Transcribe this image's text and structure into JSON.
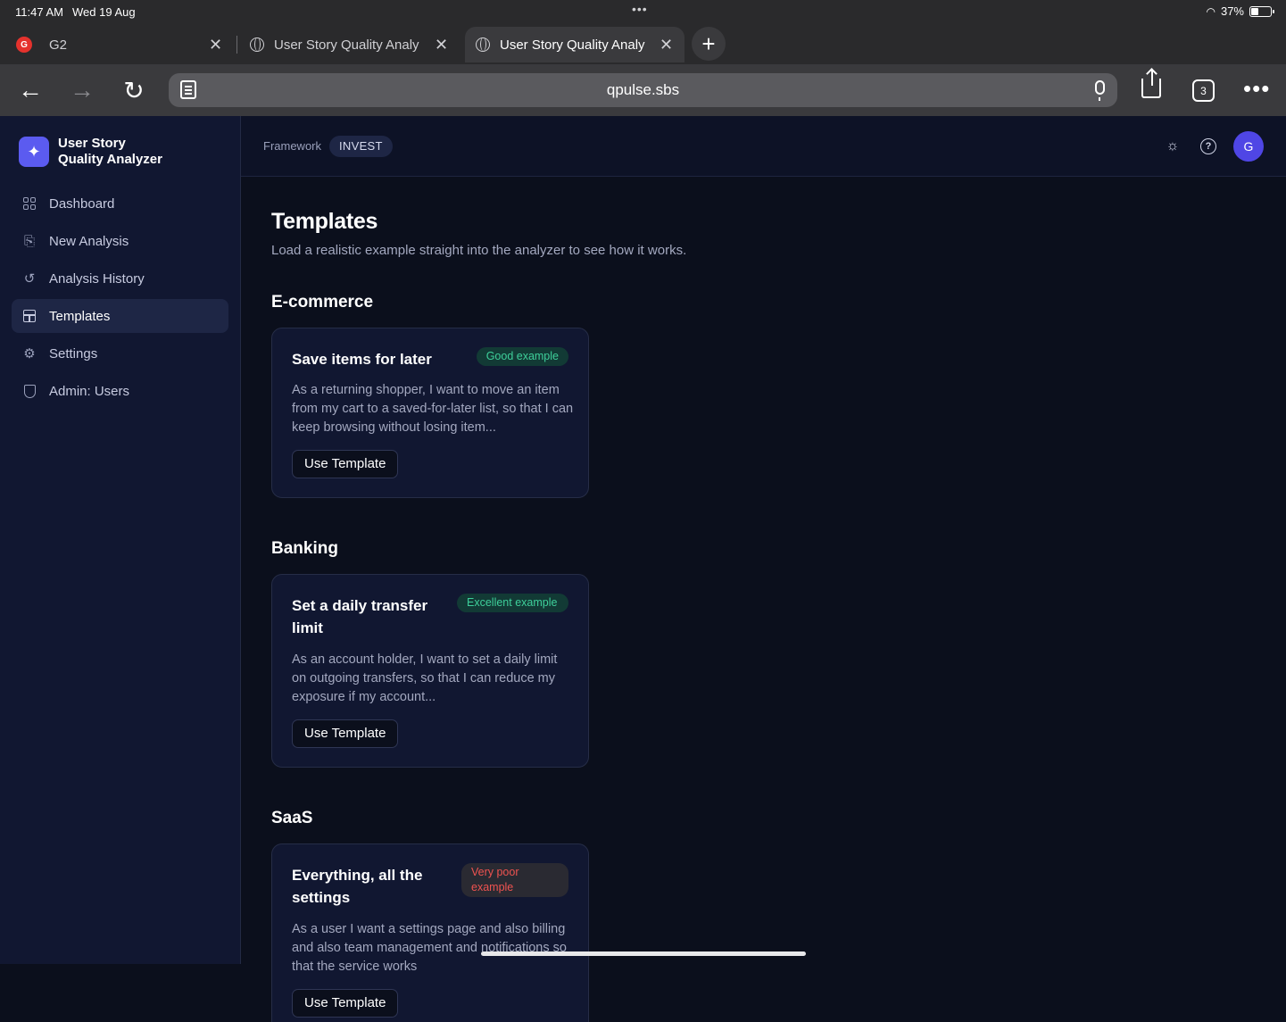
{
  "status": {
    "time": "11:47 AM",
    "date": "Wed 19 Aug",
    "battery": "37%"
  },
  "browser": {
    "tabs": [
      {
        "title": "G2"
      },
      {
        "title": "User Story Quality Analy"
      },
      {
        "title": "User Story Quality Analy"
      }
    ],
    "url": "qpulse.sbs",
    "tab_count": "3"
  },
  "app": {
    "brand": {
      "name": "User Story Quality Analyzer"
    },
    "nav": [
      {
        "label": "Dashboard"
      },
      {
        "label": "New Analysis"
      },
      {
        "label": "Analysis History"
      },
      {
        "label": "Templates"
      },
      {
        "label": "Settings"
      },
      {
        "label": "Admin: Users"
      }
    ],
    "topbar": {
      "framework_label": "Framework",
      "framework_value": "INVEST",
      "avatar_initial": "G"
    },
    "page": {
      "title": "Templates",
      "subtitle": "Load a realistic example straight into the analyzer to see how it works."
    },
    "sections": [
      {
        "title": "E-commerce",
        "card": {
          "title": "Save items for later",
          "badge": "Good example",
          "description": "As a returning shopper, I want to move an item from my cart to a saved-for-later list, so that I can keep browsing without losing item...",
          "button": "Use Template"
        }
      },
      {
        "title": "Banking",
        "card": {
          "title": "Set a daily transfer limit",
          "badge": "Excellent example",
          "description": "As an account holder, I want to set a daily limit on outgoing transfers, so that I can reduce my exposure if my account...",
          "button": "Use Template"
        }
      },
      {
        "title": "SaaS",
        "card": {
          "title": "Everything, all the settings",
          "badge": "Very poor example",
          "description": "As a user I want a settings page and also billing and also team management and notifications so that the service works",
          "button": "Use Template"
        }
      }
    ],
    "colors": {
      "accent": "#5b5bf0",
      "good": "#3ecf9a",
      "poor": "#ef5350"
    }
  }
}
